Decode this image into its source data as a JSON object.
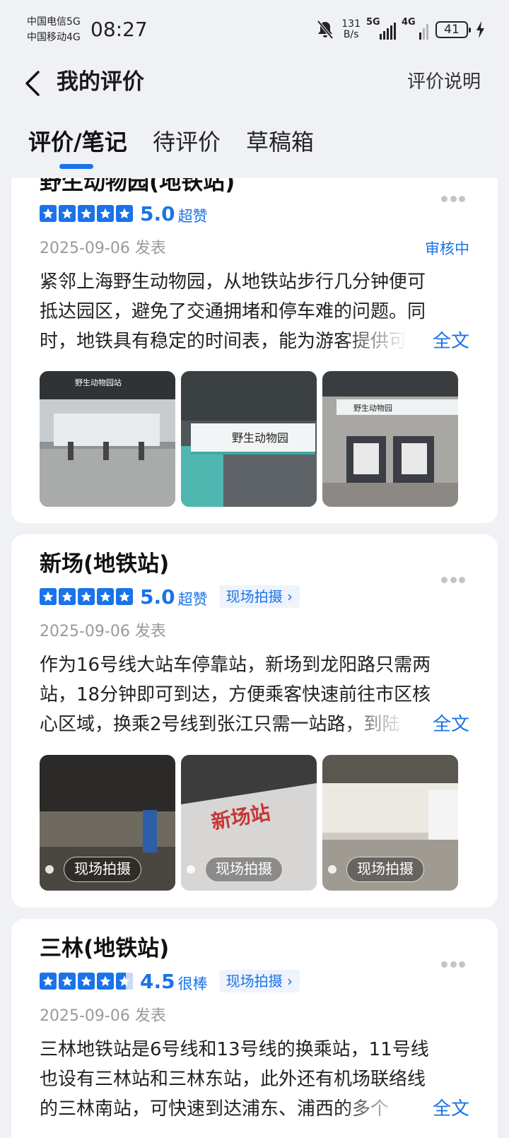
{
  "status_bar": {
    "carrier_1": "中国电信5G",
    "carrier_2": "中国移动4G",
    "time": "08:27",
    "net_speed_value": "131",
    "net_speed_unit": "B/s",
    "signal_1": "5G",
    "signal_2": "4G",
    "battery": "41"
  },
  "header": {
    "title": "我的评价",
    "help_link": "评价说明"
  },
  "tabs": [
    {
      "label": "评价/笔记",
      "active": true
    },
    {
      "label": "待评价",
      "active": false
    },
    {
      "label": "草稿箱",
      "active": false
    }
  ],
  "reviews": [
    {
      "place": "野生动物园(地铁站)",
      "rating": 5.0,
      "score": "5.0",
      "score_word": "超赞",
      "date": "2025-09-06 发表",
      "status": "审核中",
      "lines": [
        "紧邻上海野生动物园，从地铁站步行几分钟便可",
        "抵达园区，避免了交通拥堵和停车难的问题。同",
        "时，地铁具有稳定的时间表，能为游客提供可"
      ],
      "full_text_label": "全文",
      "photo_labels": [
        "野生动物园站",
        "野生动物园",
        "野生动物园"
      ]
    },
    {
      "place": "新场(地铁站)",
      "rating": 5.0,
      "score": "5.0",
      "score_word": "超赞",
      "onsite_tag": "现场拍摄 ›",
      "date": "2025-09-06 发表",
      "lines": [
        "作为16号线大站车停靠站，新场到龙阳路只需两",
        "站，18分钟即可到达，方便乘客快速前往市区核",
        "心区域，换乘2号线到张江只需一站路，到陆"
      ],
      "full_text_label": "全文",
      "photo_tag": "现场拍摄",
      "photo_labels": [
        "新场站"
      ]
    },
    {
      "place": "三林(地铁站)",
      "rating": 4.5,
      "score": "4.5",
      "score_word": "很棒",
      "onsite_tag": "现场拍摄 ›",
      "date": "2025-09-06 发表",
      "lines": [
        "三林地铁站是6号线和13号线的换乘站，11号线",
        "也设有三林站和三林东站，此外还有机场联络线",
        "的三林南站，可快速到达浦东、浦西的多个"
      ],
      "full_text_label": "全文"
    }
  ],
  "colors": {
    "accent": "#1a73e8",
    "background": "#eff1f5",
    "card": "#ffffff",
    "muted_text": "#9a9a9a"
  },
  "icons": [
    "back-arrow-icon",
    "mute-bell-icon",
    "charging-bolt-icon",
    "more-dots-icon",
    "star-icon"
  ]
}
